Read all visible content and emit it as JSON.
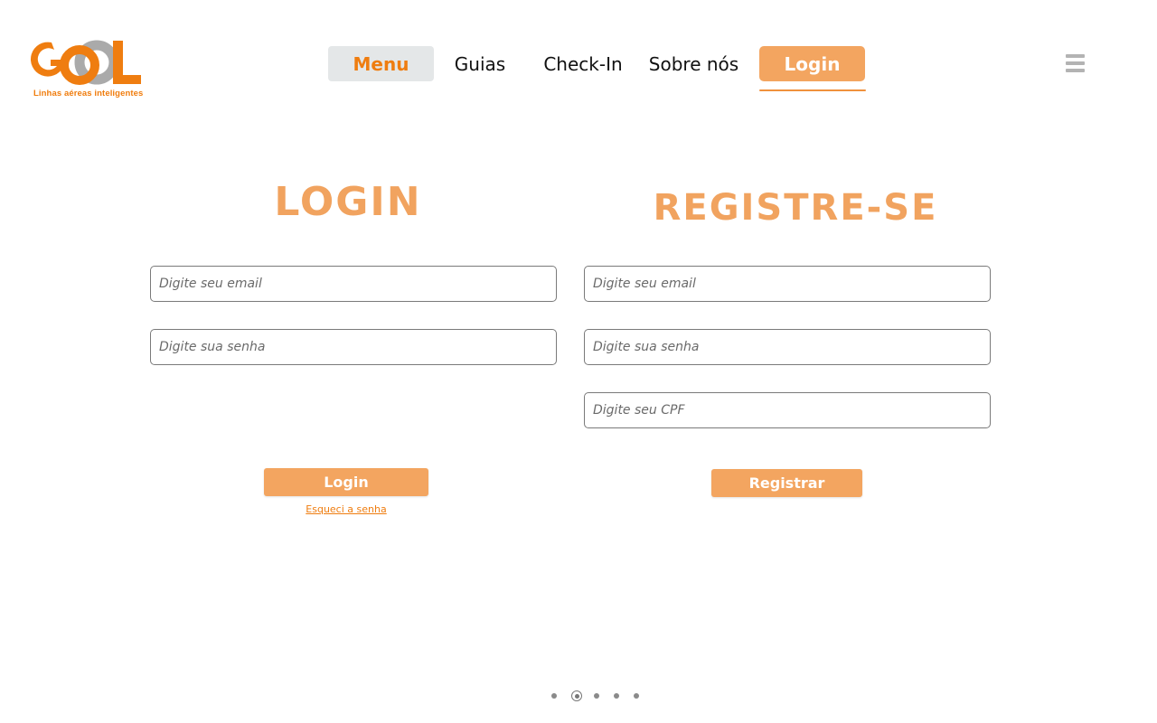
{
  "logo": {
    "text": "GOOL",
    "tagline": "Linhas aéreas inteligentes"
  },
  "nav": {
    "items": [
      {
        "label": "Menu",
        "name": "nav-menu"
      },
      {
        "label": "Guias",
        "name": "nav-guias"
      },
      {
        "label": "Check-In",
        "name": "nav-check-in"
      },
      {
        "label": "Sobre nós",
        "name": "nav-sobre-nos"
      },
      {
        "label": "Login",
        "name": "nav-login"
      }
    ],
    "active": "Login"
  },
  "menu_icon": "hamburger-menu-icon",
  "login": {
    "heading": "LOGIN",
    "email_placeholder": "Digite seu email",
    "password_placeholder": "Digite sua senha",
    "button_label": "Login",
    "forgot_label": "Esqueci a senha"
  },
  "register": {
    "heading": "REGISTRE-SE",
    "email_placeholder": "Digite seu email",
    "password_placeholder": "Digite sua senha",
    "cpf_placeholder": "Digite seu CPF",
    "button_label": "Registrar"
  },
  "pagination": {
    "total": 5,
    "current": 2
  },
  "colors": {
    "accent": "#f3a560",
    "brand_orange": "#ef7d10",
    "logo_gray": "#aaaaaa",
    "nav_highlight": "#e4e7e8"
  }
}
